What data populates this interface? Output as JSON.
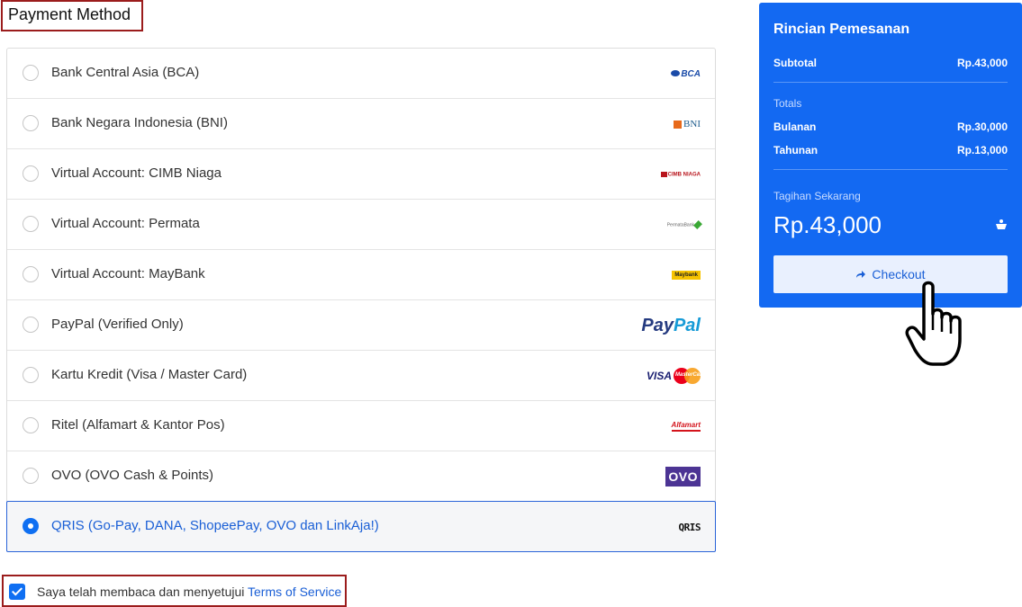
{
  "payment": {
    "title": "Payment Method",
    "methods": [
      {
        "label": "Bank Central Asia (BCA)",
        "logo": "BCA",
        "selected": false
      },
      {
        "label": "Bank Negara Indonesia (BNI)",
        "logo": "BNI",
        "selected": false
      },
      {
        "label": "Virtual Account: CIMB Niaga",
        "logo": "CIMB NIAGA",
        "selected": false
      },
      {
        "label": "Virtual Account: Permata",
        "logo": "PermataBank",
        "selected": false
      },
      {
        "label": "Virtual Account: MayBank",
        "logo": "Maybank",
        "selected": false
      },
      {
        "label": "PayPal (Verified Only)",
        "logo_part1": "Pay",
        "logo_part2": "Pal",
        "selected": false
      },
      {
        "label": "Kartu Kredit (Visa / Master Card)",
        "logo": "VISA",
        "logo2": "MasterCard",
        "selected": false
      },
      {
        "label": "Ritel (Alfamart & Kantor Pos)",
        "logo": "Alfamart",
        "selected": false
      },
      {
        "label": "OVO (OVO Cash & Points)",
        "logo": "OVO",
        "selected": false
      },
      {
        "label": "QRIS (Go-Pay, DANA, ShopeePay, OVO dan LinkAja!)",
        "logo": "QRIS",
        "selected": true
      }
    ]
  },
  "terms": {
    "checked": true,
    "text": "Saya telah membaca dan menyetujui ",
    "link": "Terms of Service"
  },
  "summary": {
    "title": "Rincian Pemesanan",
    "subtotal_label": "Subtotal",
    "subtotal_value": "Rp.43,000",
    "totals_label": "Totals",
    "monthly_label": "Bulanan",
    "monthly_value": "Rp.30,000",
    "yearly_label": "Tahunan",
    "yearly_value": "Rp.13,000",
    "due_label": "Tagihan Sekarang",
    "due_value": "Rp.43,000",
    "checkout_label": "Checkout"
  },
  "colors": {
    "accent": "#1369f2",
    "selected_border": "#2a64d8",
    "highlight_box": "#9b1c1c"
  },
  "icons": {
    "cart": "cart-icon",
    "checkout": "arrow-right-icon",
    "pointer": "hand-pointer-icon"
  }
}
